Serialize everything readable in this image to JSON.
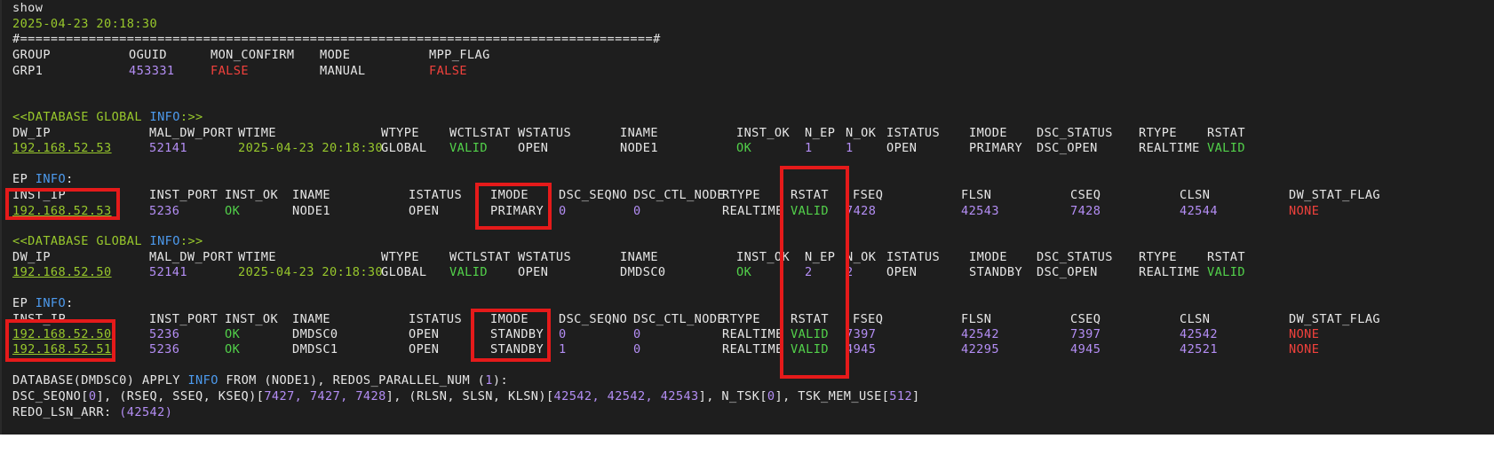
{
  "header": {
    "command": "show",
    "timestamp": "2025-04-23 20:18:30",
    "separator": "#===================================================================================#"
  },
  "group_table": {
    "headers": [
      "GROUP",
      "OGUID",
      "MON_CONFIRM",
      "MODE",
      "MPP_FLAG"
    ],
    "row": [
      "GRP1",
      "453331",
      "FALSE",
      "MANUAL",
      "FALSE"
    ]
  },
  "global_info_label": {
    "prefix": "<<DATABASE GLOBAL ",
    "info": "INFO",
    "suffix": ":>>"
  },
  "global_headers": [
    "DW_IP",
    "MAL_DW_PORT",
    "WTIME",
    "WTYPE",
    "WCTLSTAT",
    "WSTATUS",
    "INAME",
    "INST_OK",
    "N_EP",
    "N_OK",
    "ISTATUS",
    "IMODE",
    "DSC_STATUS",
    "RTYPE",
    "RSTAT"
  ],
  "ep_info_label": {
    "prefix": "EP ",
    "info": "INFO",
    "suffix": ":"
  },
  "ep_headers": [
    "INST_IP",
    "INST_PORT",
    "INST_OK",
    "INAME",
    "ISTATUS",
    "IMODE",
    "DSC_SEQNO",
    "DSC_CTL_NODE",
    "RTYPE",
    "RSTAT",
    "FSEQ",
    "FLSN",
    "CSEQ",
    "CLSN",
    "DW_STAT_FLAG"
  ],
  "db1": {
    "global": [
      "192.168.52.53",
      "52141",
      "2025-04-23 20:18:30",
      "GLOBAL",
      "VALID",
      "OPEN",
      "NODE1",
      "OK",
      "1",
      "1",
      "OPEN",
      "PRIMARY",
      "DSC_OPEN",
      "REALTIME",
      "VALID"
    ],
    "ep_rows": [
      [
        "192.168.52.53",
        "5236",
        "OK",
        "NODE1",
        "OPEN",
        "PRIMARY",
        "0",
        "0",
        "REALTIME",
        "VALID",
        "7428",
        "42543",
        "7428",
        "42544",
        "NONE"
      ]
    ]
  },
  "db2": {
    "global": [
      "192.168.52.50",
      "52141",
      "2025-04-23 20:18:30",
      "GLOBAL",
      "VALID",
      "OPEN",
      "DMDSC0",
      "OK",
      "2",
      "2",
      "OPEN",
      "STANDBY",
      "DSC_OPEN",
      "REALTIME",
      "VALID"
    ],
    "ep_rows": [
      [
        "192.168.52.50",
        "5236",
        "OK",
        "DMDSC0",
        "OPEN",
        "STANDBY",
        "0",
        "0",
        "REALTIME",
        "VALID",
        "7397",
        "42542",
        "7397",
        "42542",
        "NONE"
      ],
      [
        "192.168.52.51",
        "5236",
        "OK",
        "DMDSC1",
        "OPEN",
        "STANDBY",
        "1",
        "0",
        "REALTIME",
        "VALID",
        "4945",
        "42295",
        "4945",
        "42521",
        "NONE"
      ]
    ]
  },
  "apply_line": {
    "t1": "DATABASE(",
    "db": "DMDSC0",
    "t2": ") APPLY ",
    "info": "INFO",
    "t3": " FROM (",
    "node": "NODE1",
    "t4": "), REDOS_PARALLEL_NUM (",
    "num": "1",
    "t5": "):"
  },
  "seq_line": {
    "label1": "DSC_SEQNO[",
    "seqno": "0",
    "mid1": "], (",
    "keys1": "RSEQ, SSEQ, KSEQ",
    "mid2": ")[",
    "vals1": "7427, 7427, 7428",
    "mid3": "], (",
    "keys2": "RLSN, SLSN, KLSN",
    "mid4": ")[",
    "vals2": "42542, 42542, 42543",
    "mid5": "], N_TSK[",
    "ntsk": "0",
    "mid6": "], TSK_MEM_USE[",
    "mem": "512",
    "end": "]"
  },
  "redo_line": {
    "label": "REDO_LSN_ARR: ",
    "value": "(42542)"
  },
  "colors": {
    "background": "#1e1e1e",
    "text": "#e6e6e6",
    "green": "#98c82c",
    "purple": "#b48ef5",
    "red": "#f0413c",
    "blue": "#4d9bef",
    "ok_green": "#52d14a",
    "highlight_box": "#e51a1a"
  }
}
